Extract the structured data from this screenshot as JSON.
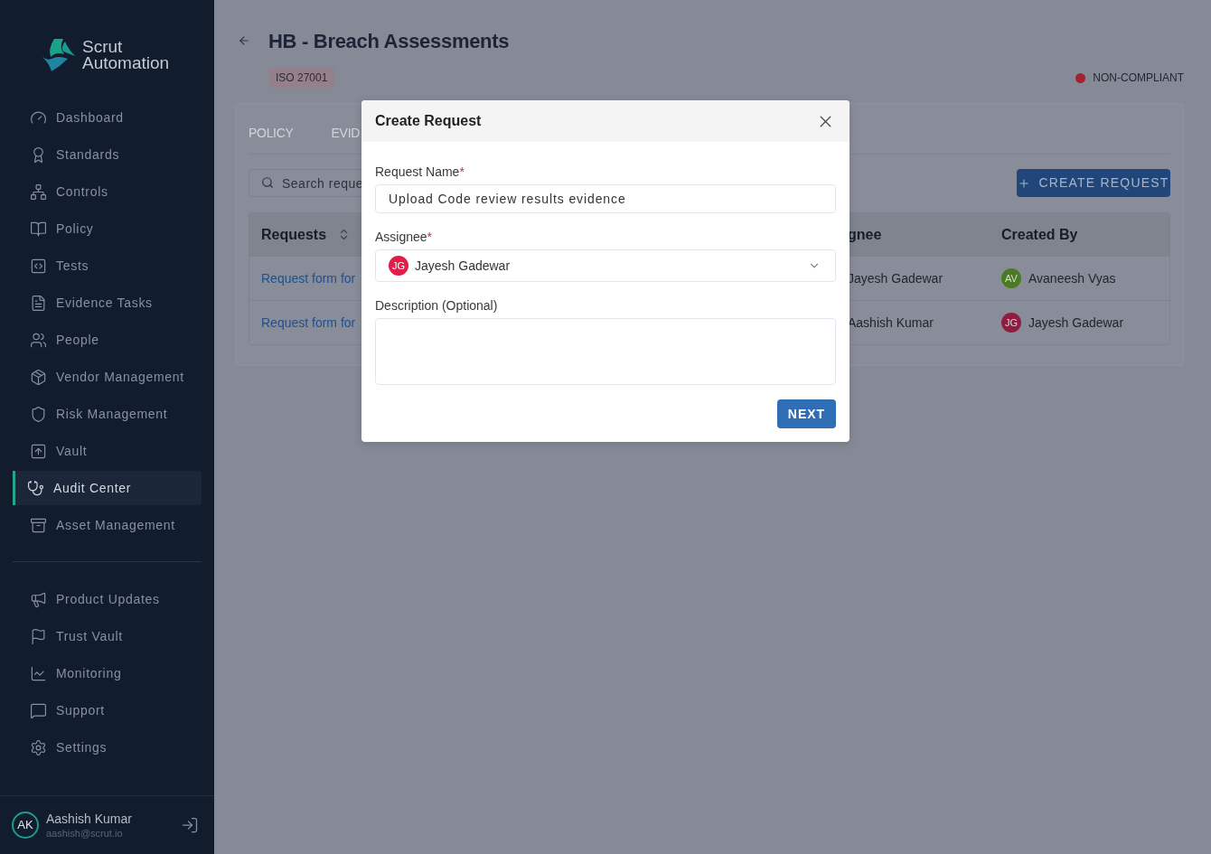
{
  "sidebar": {
    "brand": {
      "line_1": "Scrut",
      "line_2": "Automation"
    },
    "nav_items": [
      {
        "label": "Dashboard",
        "selected": false
      },
      {
        "label": "Standards",
        "selected": false
      },
      {
        "label": "Controls",
        "selected": false
      },
      {
        "label": "Policy",
        "selected": false
      },
      {
        "label": "Tests",
        "selected": false
      },
      {
        "label": "Evidence Tasks",
        "selected": false
      },
      {
        "label": "People",
        "selected": false
      },
      {
        "label": "Vendor Management",
        "selected": false
      },
      {
        "label": "Risk Management",
        "selected": false
      },
      {
        "label": "Vault",
        "selected": false
      },
      {
        "label": "Audit Center",
        "selected": true
      },
      {
        "label": "Asset Management",
        "selected": false
      }
    ],
    "secondary_items": [
      {
        "label": "Product Updates",
        "selected": false
      },
      {
        "label": "Trust Vault",
        "selected": false
      },
      {
        "label": "Monitoring",
        "selected": false
      },
      {
        "label": "Support",
        "selected": false
      },
      {
        "label": "Settings",
        "selected": false
      }
    ],
    "user": {
      "initials": "AK",
      "name": "Aashish Kumar",
      "email": "aashish@scrut.io"
    }
  },
  "page": {
    "title": "HB - Breach Assessments",
    "standard_tag": "ISO 27001",
    "status": "NON-COMPLIANT"
  },
  "tabs": [
    {
      "label": "POLICY",
      "selected": false
    },
    {
      "label": "EVID",
      "selected": false
    }
  ],
  "search": {
    "placeholder": "Search reque"
  },
  "create_button": "CREATE REQUEST",
  "table": {
    "columns": [
      {
        "label": "Requests",
        "sortable": true
      },
      {
        "label": "gnee",
        "sortable": false
      },
      {
        "label": "Created By",
        "sortable": false
      }
    ],
    "rows": [
      {
        "request": "Request form for",
        "assignee": "Jayesh Gadewar",
        "created_by": {
          "initials": "AV",
          "name": "Avaneesh Vyas",
          "color": "#4b7a20"
        }
      },
      {
        "request": "Request form for",
        "assignee": "Aashish Kumar",
        "created_by": {
          "initials": "JG",
          "name": "Jayesh Gadewar",
          "color": "#8f1d40"
        }
      }
    ]
  },
  "modal": {
    "title": "Create Request",
    "fields": [
      {
        "kind": "text",
        "label": "Request Name",
        "required_mark": "*",
        "value": "Upload Code review results evidence"
      },
      {
        "kind": "select",
        "label": "Assignee",
        "required_mark": "*",
        "value": {
          "initials": "JG",
          "name": "Jayesh Gadewar"
        }
      },
      {
        "kind": "textarea",
        "label": "Description (Optional)"
      }
    ],
    "submit_button": "NEXT"
  }
}
